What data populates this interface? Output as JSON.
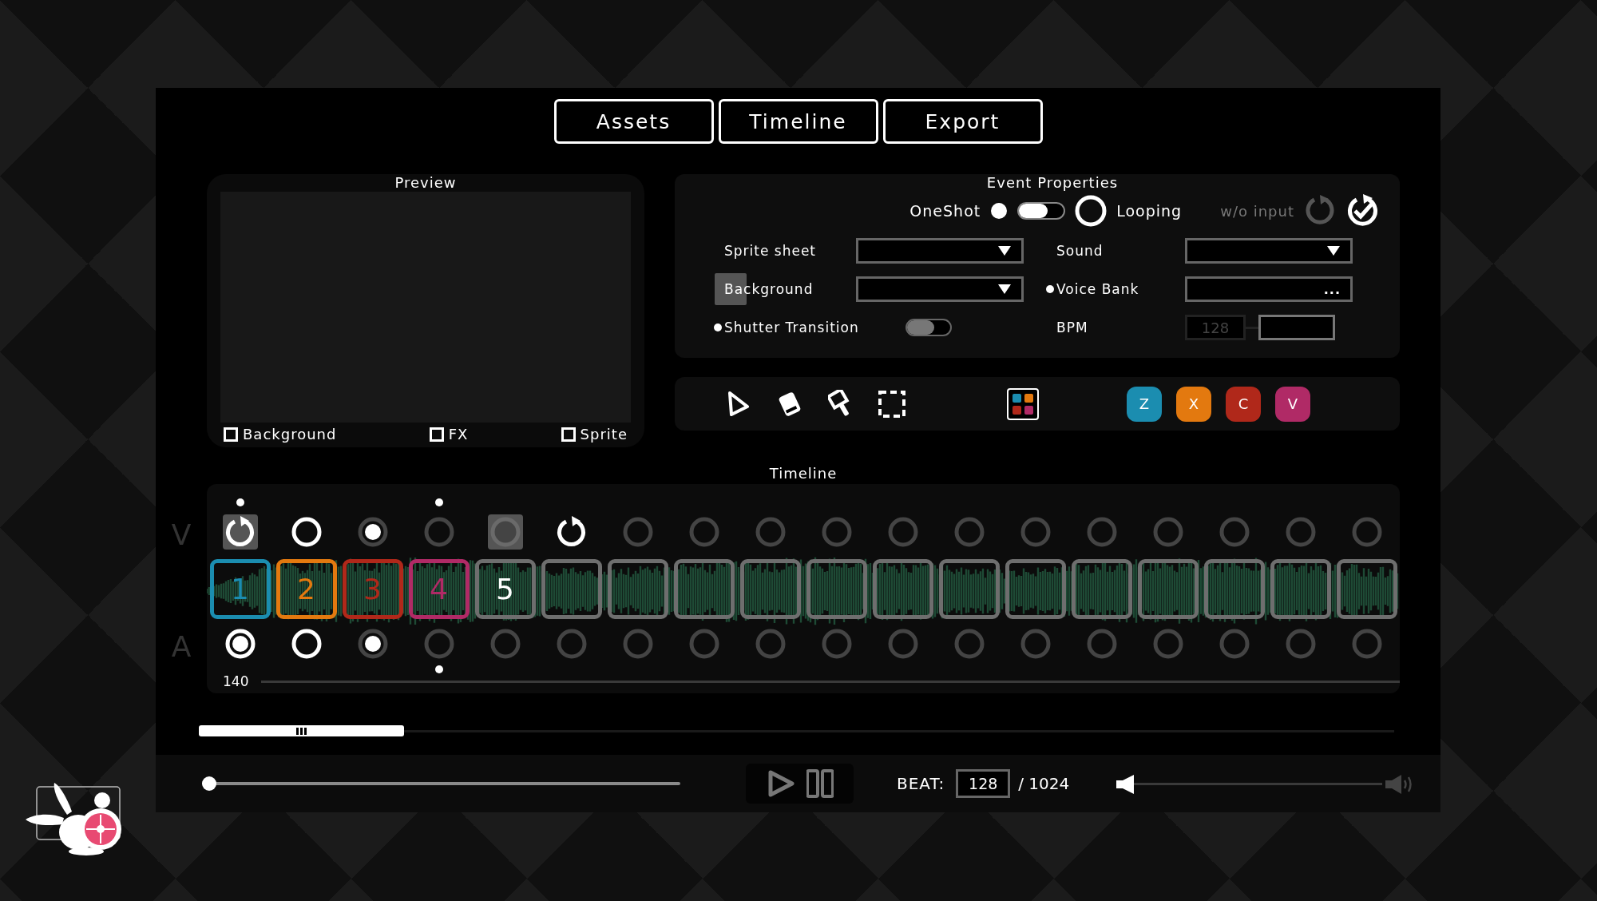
{
  "tabs": [
    {
      "label": "Assets"
    },
    {
      "label": "Timeline"
    },
    {
      "label": "Export"
    }
  ],
  "preview": {
    "title": "Preview",
    "layers": [
      {
        "label": "Background",
        "checked": false
      },
      {
        "label": "FX",
        "checked": false
      },
      {
        "label": "Sprite",
        "checked": false
      }
    ]
  },
  "event_properties": {
    "title": "Event Properties",
    "mode": [
      {
        "label": "OneShot",
        "selected": true
      },
      {
        "label": "Looping",
        "selected": false
      }
    ],
    "without_input": {
      "label": "w/o input",
      "disabled": true,
      "checked": true
    },
    "fields": [
      {
        "kind": "dropdown",
        "label": "Sprite sheet",
        "marked": false,
        "hovered": false
      },
      {
        "kind": "dropdown",
        "label": "Background",
        "marked": false,
        "hovered": true
      },
      {
        "kind": "switch",
        "label": "Shutter Transition",
        "marked": true,
        "hovered": false,
        "on": false
      },
      {
        "kind": "dropdown",
        "label": "Sound",
        "marked": false,
        "hovered": false
      },
      {
        "kind": "browse",
        "label": "Voice Bank",
        "marked": true,
        "hovered": false,
        "button": "..."
      },
      {
        "kind": "number",
        "label": "BPM",
        "marked": false,
        "hovered": false,
        "value": "128",
        "disabled": true
      }
    ]
  },
  "toolbar": {
    "tools": [
      {
        "kind": "pointer"
      },
      {
        "kind": "eraser"
      },
      {
        "kind": "pin"
      },
      {
        "kind": "marquee"
      }
    ],
    "palette": {
      "selected": true
    },
    "keys": [
      {
        "label": "Z",
        "color": "#1b8db0"
      },
      {
        "label": "X",
        "color": "#e3790f"
      },
      {
        "label": "C",
        "color": "#b0281a"
      },
      {
        "label": "V",
        "color": "#b02a66"
      }
    ]
  },
  "timeline": {
    "title": "Timeline",
    "row_labels": [
      "V",
      "A"
    ],
    "zoom_value": "140",
    "columns": [
      {
        "top": {
          "kind": "loop",
          "selected": true,
          "marked": true
        },
        "card": {
          "kind": "key",
          "label": "1",
          "color": "#1b8db0"
        },
        "bottom": {
          "kind": "target",
          "selected": false,
          "marked": false
        }
      },
      {
        "top": {
          "kind": "ring",
          "selected": false,
          "marked": false
        },
        "card": {
          "kind": "key",
          "label": "2",
          "color": "#e3790f"
        },
        "bottom": {
          "kind": "ring",
          "selected": false,
          "marked": false
        }
      },
      {
        "top": {
          "kind": "filled",
          "selected": false,
          "marked": false
        },
        "card": {
          "kind": "key",
          "label": "3",
          "color": "#b0281a"
        },
        "bottom": {
          "kind": "filled",
          "selected": false,
          "marked": false
        }
      },
      {
        "top": {
          "kind": "empty",
          "selected": false,
          "marked": true
        },
        "card": {
          "kind": "key",
          "label": "4",
          "color": "#b02a66"
        },
        "bottom": {
          "kind": "empty",
          "selected": false,
          "marked": true
        }
      },
      {
        "top": {
          "kind": "solid",
          "selected": true,
          "marked": false
        },
        "card": {
          "kind": "plain",
          "label": "5",
          "color": "#6e6e6e"
        },
        "bottom": {
          "kind": "empty",
          "selected": false,
          "marked": false
        }
      },
      {
        "top": {
          "kind": "loop",
          "selected": false,
          "marked": false
        },
        "card": {
          "kind": "plain",
          "color": "#6e6e6e"
        },
        "bottom": {
          "kind": "empty",
          "selected": false,
          "marked": false
        }
      },
      {
        "top": {
          "kind": "empty",
          "selected": false,
          "marked": false
        },
        "card": {
          "kind": "plain",
          "color": "#6e6e6e"
        },
        "bottom": {
          "kind": "empty",
          "selected": false,
          "marked": false
        }
      },
      {
        "top": {
          "kind": "empty",
          "selected": false,
          "marked": false
        },
        "card": {
          "kind": "plain",
          "color": "#6e6e6e"
        },
        "bottom": {
          "kind": "empty",
          "selected": false,
          "marked": false
        }
      },
      {
        "top": {
          "kind": "empty",
          "selected": false,
          "marked": false
        },
        "card": {
          "kind": "plain",
          "color": "#6e6e6e"
        },
        "bottom": {
          "kind": "empty",
          "selected": false,
          "marked": false
        }
      },
      {
        "top": {
          "kind": "empty",
          "selected": false,
          "marked": false
        },
        "card": {
          "kind": "plain",
          "color": "#6e6e6e"
        },
        "bottom": {
          "kind": "empty",
          "selected": false,
          "marked": false
        }
      },
      {
        "top": {
          "kind": "empty",
          "selected": false,
          "marked": false
        },
        "card": {
          "kind": "plain",
          "color": "#6e6e6e"
        },
        "bottom": {
          "kind": "empty",
          "selected": false,
          "marked": false
        }
      },
      {
        "top": {
          "kind": "empty",
          "selected": false,
          "marked": false
        },
        "card": {
          "kind": "plain",
          "color": "#6e6e6e"
        },
        "bottom": {
          "kind": "empty",
          "selected": false,
          "marked": false
        }
      },
      {
        "top": {
          "kind": "empty",
          "selected": false,
          "marked": false
        },
        "card": {
          "kind": "plain",
          "color": "#6e6e6e"
        },
        "bottom": {
          "kind": "empty",
          "selected": false,
          "marked": false
        }
      },
      {
        "top": {
          "kind": "empty",
          "selected": false,
          "marked": false
        },
        "card": {
          "kind": "plain",
          "color": "#6e6e6e"
        },
        "bottom": {
          "kind": "empty",
          "selected": false,
          "marked": false
        }
      },
      {
        "top": {
          "kind": "empty",
          "selected": false,
          "marked": false
        },
        "card": {
          "kind": "plain",
          "color": "#6e6e6e"
        },
        "bottom": {
          "kind": "empty",
          "selected": false,
          "marked": false
        }
      },
      {
        "top": {
          "kind": "empty",
          "selected": false,
          "marked": false
        },
        "card": {
          "kind": "plain",
          "color": "#6e6e6e"
        },
        "bottom": {
          "kind": "empty",
          "selected": false,
          "marked": false
        }
      },
      {
        "top": {
          "kind": "empty",
          "selected": false,
          "marked": false
        },
        "card": {
          "kind": "plain",
          "color": "#6e6e6e"
        },
        "bottom": {
          "kind": "empty",
          "selected": false,
          "marked": false
        }
      },
      {
        "top": {
          "kind": "empty",
          "selected": false,
          "marked": false
        },
        "card": {
          "kind": "plain",
          "color": "#6e6e6e"
        },
        "bottom": {
          "kind": "empty",
          "selected": false,
          "marked": false
        }
      }
    ]
  },
  "transport": {
    "seek": {
      "level": 0
    },
    "beat_label": "BEAT:",
    "beat_value": "128",
    "beat_total": "/ 1024",
    "volume": {
      "level": 0
    }
  }
}
